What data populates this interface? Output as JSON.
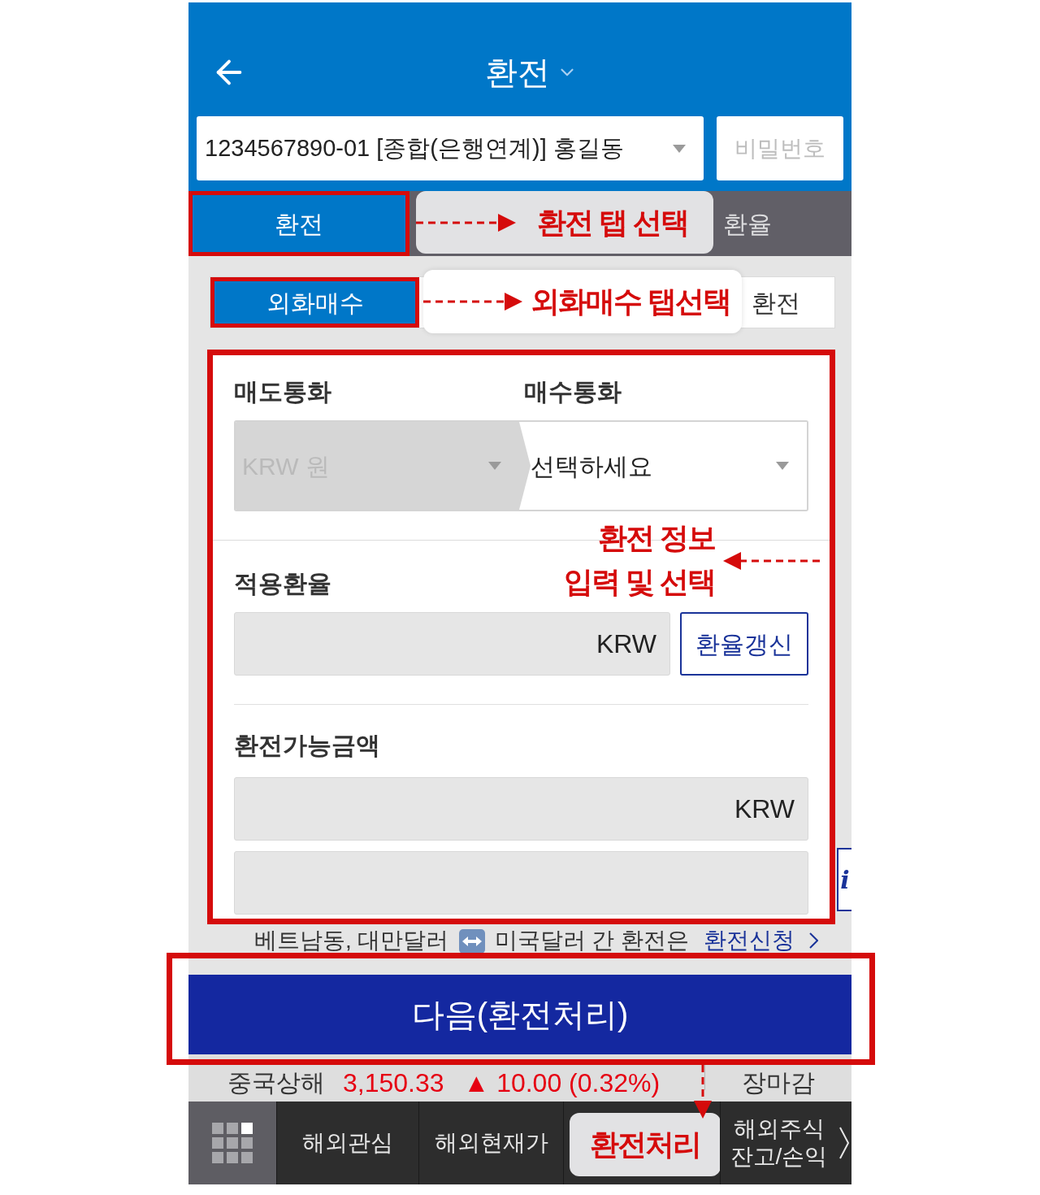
{
  "header": {
    "title": "환전"
  },
  "account": {
    "value": "1234567890-01 [종합(은행연계)] 홍길동",
    "password_placeholder": "비밀번호"
  },
  "tabs": [
    {
      "label": "환전",
      "selected": true,
      "highlighted": true
    },
    {
      "label": "환율",
      "selected": false,
      "highlighted": false
    }
  ],
  "tabs_callout": {
    "text": "환전 탭 선택"
  },
  "sub_tabs": [
    {
      "label": "외화매수",
      "selected": true,
      "highlighted": true
    },
    {
      "label": "환전",
      "selected": false,
      "highlighted": false
    }
  ],
  "sub_tabs_callout": {
    "text": "외화매수 탭선택"
  },
  "form": {
    "highlighted": true,
    "callout": {
      "lines": [
        "환전 정보",
        "입력 및 선택"
      ]
    },
    "sell_currency": {
      "label": "매도통화",
      "value": "KRW 원",
      "disabled": true
    },
    "buy_currency": {
      "label": "매수통화",
      "value": "선택하세요",
      "disabled": false
    },
    "rate": {
      "label": "적용환율",
      "unit": "KRW",
      "button": "환율갱신"
    },
    "available": {
      "label": "환전가능금액",
      "unit": "KRW"
    }
  },
  "info_tab": {
    "label": "i"
  },
  "notice": {
    "before": "베트남동, 대만달러",
    "after": "미국달러 간 환전은",
    "link": "환전신청"
  },
  "next_button": {
    "label": "다음(환전처리)",
    "highlighted": true
  },
  "ticker": {
    "name": "중국상해",
    "price": "3,150.33",
    "change": "▲ 10.00 (0.32%)",
    "status": "장마감"
  },
  "bottom_nav": [
    {
      "kind": "menu",
      "label": "해외관심"
    },
    {
      "kind": "menu",
      "label": "해외현재가"
    },
    {
      "kind": "callout",
      "label": "환전처리"
    },
    {
      "kind": "menu",
      "label": "해외주식\n잔고/손익"
    }
  ]
}
